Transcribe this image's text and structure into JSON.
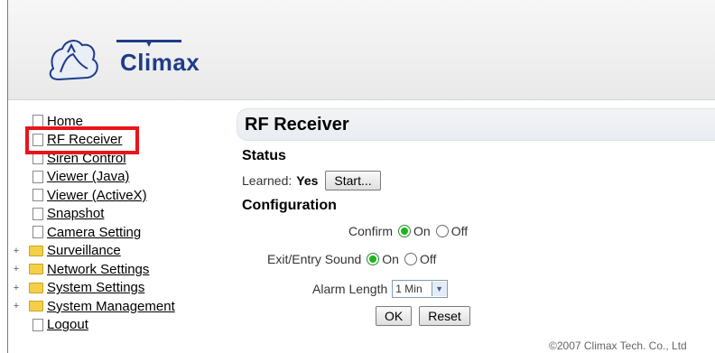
{
  "header": {
    "brand": "Climax",
    "logo_icon": "climax-logo-icon"
  },
  "nav": {
    "items": [
      {
        "label": "Home",
        "icon": "document-icon"
      },
      {
        "label": "RF Receiver",
        "icon": "document-icon"
      },
      {
        "label": "Siren Control",
        "icon": "document-icon"
      },
      {
        "label": "Viewer (Java)",
        "icon": "document-icon"
      },
      {
        "label": "Viewer (ActiveX)",
        "icon": "document-icon"
      },
      {
        "label": "Snapshot",
        "icon": "document-icon"
      },
      {
        "label": "Camera Setting",
        "icon": "document-icon"
      },
      {
        "label": "Surveillance",
        "icon": "folder-icon",
        "expand": "+"
      },
      {
        "label": "Network Settings",
        "icon": "folder-icon",
        "expand": "+"
      },
      {
        "label": "System Settings",
        "icon": "folder-icon",
        "expand": "+"
      },
      {
        "label": "System Management",
        "icon": "folder-icon",
        "expand": "+"
      },
      {
        "label": "Logout",
        "icon": "document-icon"
      }
    ],
    "highlighted_item": "RF Receiver",
    "highlight_color": "#e8141c"
  },
  "main": {
    "title": "RF Receiver",
    "status": {
      "heading": "Status",
      "learned_label": "Learned:",
      "learned_value": "Yes",
      "start_button": "Start..."
    },
    "configuration": {
      "heading": "Configuration",
      "confirm": {
        "label": "Confirm",
        "on": "On",
        "off": "Off",
        "selected": "On"
      },
      "exit_entry_sound": {
        "label": "Exit/Entry Sound",
        "on": "On",
        "off": "Off",
        "selected": "On"
      },
      "alarm_length": {
        "label": "Alarm Length",
        "value": "1 Min"
      }
    },
    "ok_button": "OK",
    "reset_button": "Reset"
  },
  "footer": {
    "copyright": "©2007 Climax Tech. Co., Ltd"
  },
  "colors": {
    "radio_selected": "#1db51d",
    "brand_blue": "#1f3c8a"
  }
}
